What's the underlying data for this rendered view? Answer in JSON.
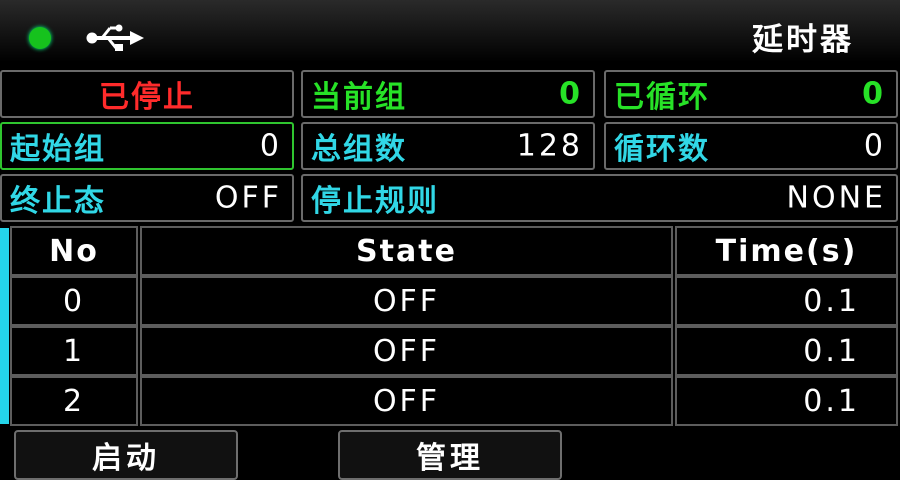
{
  "title": "延时器",
  "colors": {
    "red": "#ff2b2b",
    "green": "#27e227",
    "cyan": "#31d7e6",
    "led": "#16c21d"
  },
  "icons": {
    "status": "status-led-icon",
    "connection": "usb-icon"
  },
  "status": {
    "run_state": "已停止"
  },
  "info": {
    "current_group_label": "当前组",
    "current_group_value": "0",
    "cycled_label": "已循环",
    "cycled_value": "0",
    "start_group_label": "起始组",
    "start_group_value": "0",
    "total_groups_label": "总组数",
    "total_groups_value": "128",
    "cycle_count_label": "循环数",
    "cycle_count_value": "0",
    "end_state_label": "终止态",
    "end_state_value": "OFF",
    "stop_rule_label": "停止规则",
    "stop_rule_value": "NONE"
  },
  "table": {
    "headers": [
      "No",
      "State",
      "Time(s)"
    ],
    "rows": [
      [
        "0",
        "OFF",
        "0.1"
      ],
      [
        "1",
        "OFF",
        "0.1"
      ],
      [
        "2",
        "OFF",
        "0.1"
      ]
    ]
  },
  "buttons": {
    "start": "启动",
    "manage": "管理"
  }
}
